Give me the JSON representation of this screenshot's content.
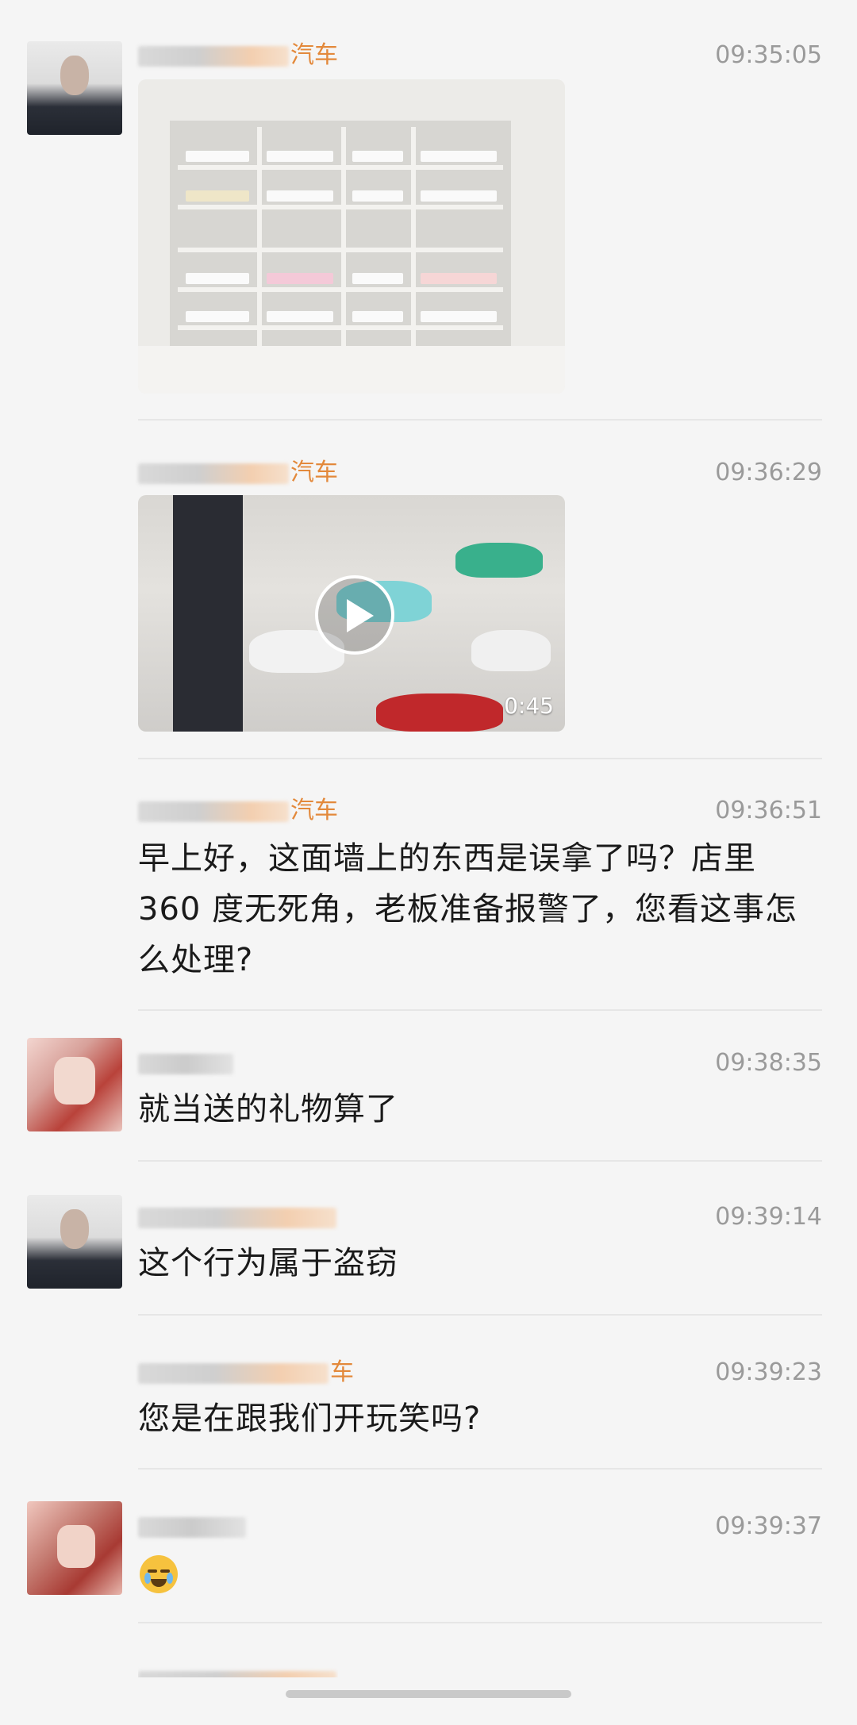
{
  "messages": [
    {
      "name_suffix": "汽车",
      "time": "09:35:05",
      "kind": "image"
    },
    {
      "name_suffix": "汽车",
      "time": "09:36:29",
      "kind": "video",
      "duration": "0:45"
    },
    {
      "name_suffix": "汽车",
      "time": "09:36:51",
      "kind": "text",
      "text": "早上好，这面墙上的东西是误拿了吗？店里 360 度无死角，老板准备报警了，您看这事怎么处理?"
    },
    {
      "name_suffix": "",
      "time": "09:38:35",
      "kind": "text",
      "text": "就当送的礼物算了"
    },
    {
      "name_suffix": "",
      "time": "09:39:14",
      "kind": "text",
      "text": "这个行为属于盗窃"
    },
    {
      "name_suffix": "车",
      "time": "09:39:23",
      "kind": "text",
      "text": "您是在跟我们开玩笑吗?"
    },
    {
      "name_suffix": "",
      "time": "09:39:37",
      "kind": "emoji",
      "emoji": "crying-face-emoji"
    }
  ]
}
